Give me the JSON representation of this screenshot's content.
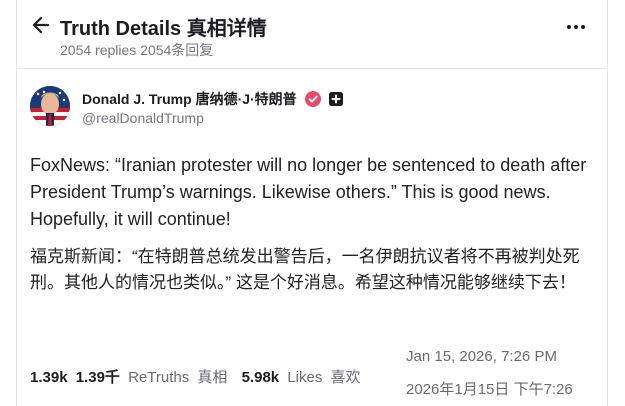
{
  "header": {
    "title": "Truth Details  真相详情",
    "replies": "2054 replies  2054条回复"
  },
  "author": {
    "display_name": "Donald J. Trump  唐纳德·J·特朗普",
    "handle": "@realDonaldTrump",
    "verified_color": "#e64b6e"
  },
  "post": {
    "text_en": "FoxNews: “Iranian protester will no longer be sentenced to death after President Trump’s warnings. Likewise others.” This is good news. Hopefully, it will continue!",
    "text_zh": "福克斯新闻：“在特朗普总统发出警告后，一名伊朗抗议者将不再被判处死刑。其他人的情况也类似。” 这是个好消息。希望这种情况能够继续下去！"
  },
  "stats": {
    "retruths_count": "1.39k",
    "retruths_count_zh": "1.39千",
    "retruths_label": "ReTruths",
    "retruths_label_zh": "真相",
    "likes_count": "5.98k",
    "likes_label": "Likes",
    "likes_label_zh": "喜欢"
  },
  "timestamp": {
    "en": "Jan 15, 2026, 7:26 PM",
    "zh": "2026年1月15日 下午7:26"
  },
  "icons": [
    "back-arrow-icon",
    "more-dots-icon",
    "verified-badge-icon",
    "plus-badge-icon"
  ]
}
